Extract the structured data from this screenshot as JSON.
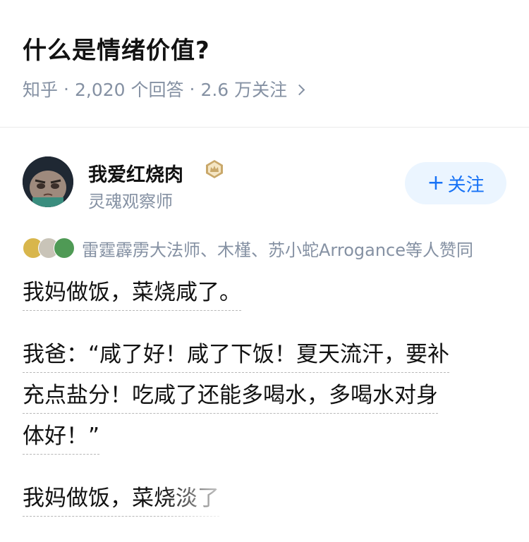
{
  "question": {
    "title": "什么是情绪价值?",
    "source": "知乎",
    "answers": "2,020 个回答",
    "followers": "2.6 万关注"
  },
  "author": {
    "name": "我爱红烧肉",
    "title": "灵魂观察师",
    "follow_label": "关注",
    "badge_icon": "crown-badge-icon"
  },
  "voters": {
    "text": "雷霆霹雳大法师、木槿、苏小蛇Arrogance等人赞同"
  },
  "content": {
    "p1": [
      "我妈做饭，菜烧咸了。"
    ],
    "p2": [
      "我爸：“咸了好！咸了下饭！夏天流汗，要补",
      "充点盐分！吃咸了还能多喝水，多喝水对身",
      "体好！”"
    ],
    "p3": [
      "我妈做饭，菜烧淡了"
    ]
  },
  "colors": {
    "accent": "#1772f6",
    "meta": "#8591a3",
    "follow_bg": "#ebf5ff"
  }
}
